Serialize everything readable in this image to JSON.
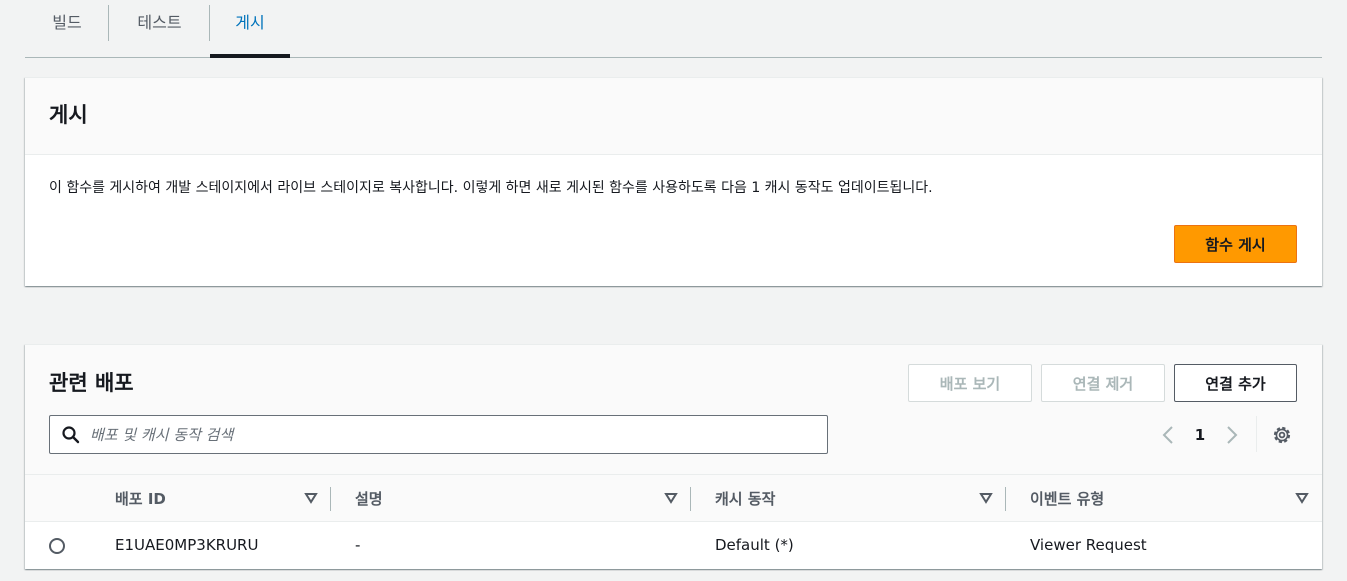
{
  "tabs": [
    {
      "label": "빌드",
      "active": false
    },
    {
      "label": "테스트",
      "active": false
    },
    {
      "label": "게시",
      "active": true
    }
  ],
  "publish": {
    "title": "게시",
    "description": "이 함수를 게시하여 개발 스테이지에서 라이브 스테이지로 복사합니다. 이렇게 하면 새로 게시된 함수를 사용하도록 다음 1 캐시 동작도 업데이트됩니다.",
    "button_label": "함수 게시"
  },
  "distributions": {
    "title": "관련 배포",
    "buttons": {
      "view": "배포 보기",
      "remove": "연결 제거",
      "add": "연결 추가"
    },
    "search": {
      "placeholder": "배포 및 캐시 동작 검색",
      "value": ""
    },
    "pagination": {
      "current_page": "1"
    },
    "columns": [
      "배포 ID",
      "설명",
      "캐시 동작",
      "이벤트 유형"
    ],
    "rows": [
      {
        "id": "E1UAE0MP3KRURU",
        "description": "-",
        "cache_behavior": "Default (*)",
        "event_type": "Viewer Request",
        "selected": false
      }
    ]
  },
  "colors": {
    "accent_blue": "#0073bb",
    "primary_orange": "#ff9900",
    "text_dark": "#16191f",
    "text_muted": "#545b64"
  },
  "icons": [
    "search-icon",
    "chevron-left-icon",
    "chevron-right-icon",
    "gear-icon",
    "sort-caret-icon"
  ]
}
